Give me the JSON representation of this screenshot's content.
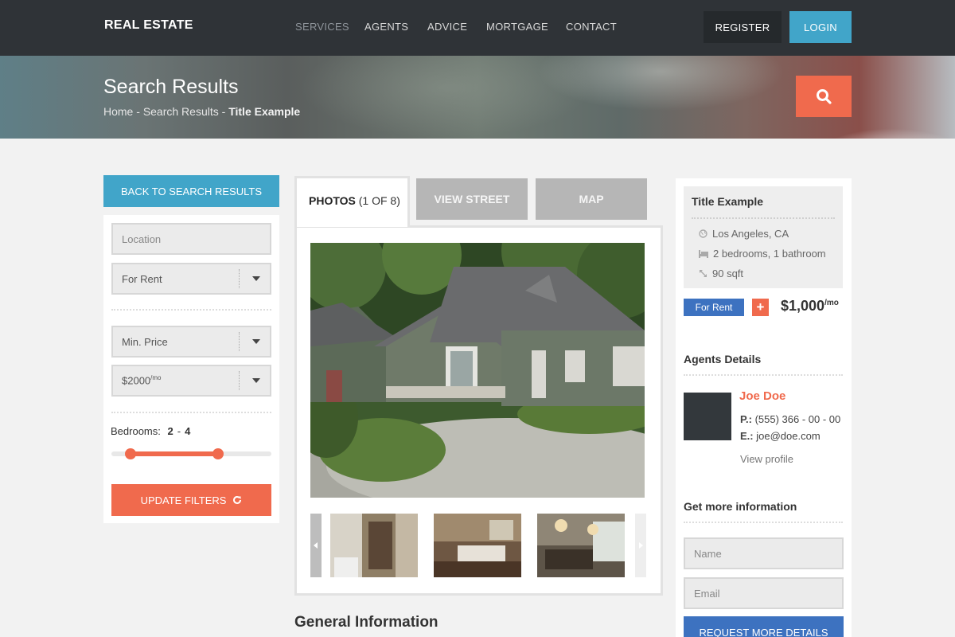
{
  "nav": {
    "logo": "REAL ESTATE",
    "items": [
      "SERVICES",
      "AGENTS",
      "ADVICE",
      "MORTGAGE",
      "CONTACT"
    ],
    "active_item": "SERVICES",
    "register": "REGISTER",
    "login": "LOGIN"
  },
  "hero": {
    "title": "Search Results",
    "breadcrumb": {
      "home": "Home",
      "sep": " - ",
      "results": "Search Results",
      "current": "Title Example"
    }
  },
  "filters": {
    "back_button": "BACK TO SEARCH RESULTS",
    "location_placeholder": "Location",
    "type_value": "For Rent",
    "min_price_value": "Min. Price",
    "max_price_value": "$2000",
    "max_price_suffix": "/mo",
    "bedrooms_label": "Bedrooms:",
    "bedrooms_min": "2",
    "bedrooms_dash": "-",
    "bedrooms_max": "4",
    "update_button": "UPDATE FILTERS"
  },
  "gallery": {
    "tab_photos": "PHOTOS",
    "tab_photos_count": "(1 OF 8)",
    "tab_street": "VIEW STREET",
    "tab_map": "MAP"
  },
  "general_info_title": "General Information",
  "listing": {
    "title": "Title Example",
    "location": "Los Angeles, CA",
    "rooms": "2 bedrooms, 1 bathroom",
    "size": "90 sqft",
    "status_badge": "For Rent",
    "plus": "+",
    "price": "$1,000",
    "price_suffix": "/mo"
  },
  "agent": {
    "section_title": "Agents Details",
    "name": "Joe Doe",
    "phone_label": "P.:",
    "phone": "(555) 366 - 00 - 00",
    "email_label": "E.:",
    "email": "joe@doe.com",
    "view_profile": "View profile"
  },
  "contact": {
    "section_title": "Get more information",
    "name_placeholder": "Name",
    "email_placeholder": "Email",
    "request_button": "REQUEST MORE DETAILS"
  },
  "colors": {
    "accent_orange": "#f06a4d",
    "accent_blue": "#41a5c9",
    "button_blue": "#3d72c0",
    "nav_bg": "#2f3337"
  }
}
